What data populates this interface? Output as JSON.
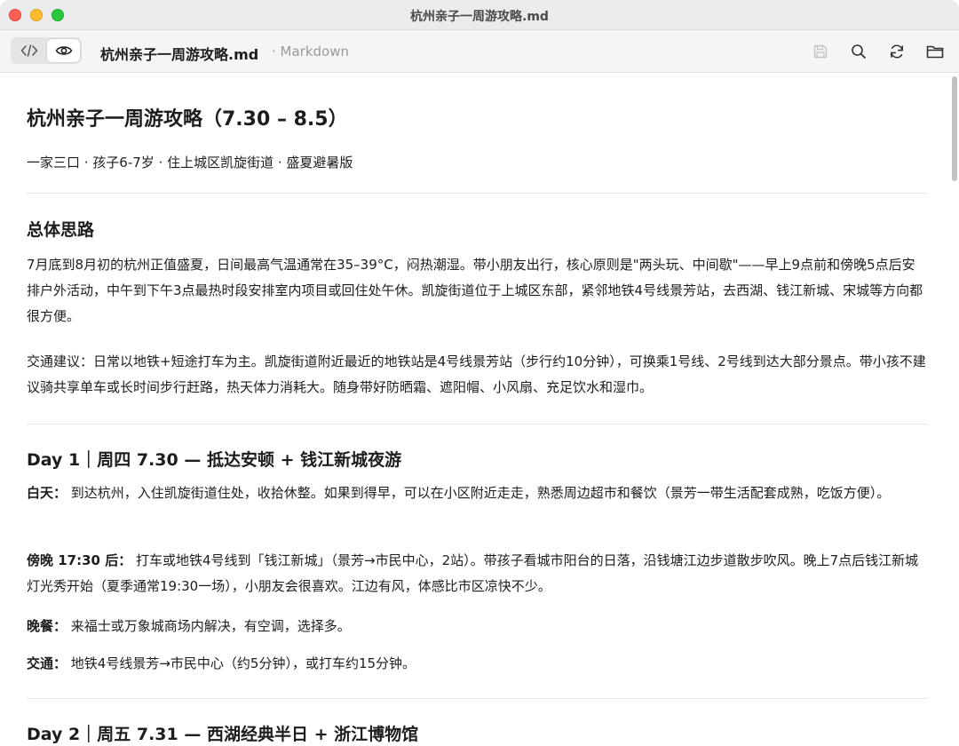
{
  "window": {
    "title": "杭州亲子一周游攻略.md"
  },
  "toolbar": {
    "file_name": "杭州亲子一周游攻略.md",
    "file_type": "· Markdown",
    "mode_code_icon": "code-icon",
    "mode_preview_icon": "eye-icon",
    "save_icon": "save-icon",
    "search_icon": "search-icon",
    "refresh_icon": "refresh-icon",
    "folder_icon": "folder-icon"
  },
  "document": {
    "title": "杭州亲子一周游攻略（7.30 – 8.5）",
    "subtitle": "一家三口 · 孩子6-7岁 · 住上城区凯旋街道 · 盛夏避暑版",
    "overview": {
      "heading": "总体思路",
      "para1": "7月底到8月初的杭州正值盛夏，日间最高气温通常在35–39°C，闷热潮湿。带小朋友出行，核心原则是\"两头玩、中间歇\"——早上9点前和傍晚5点后安排户外活动，中午到下午3点最热时段安排室内项目或回住处午休。凯旋街道位于上城区东部，紧邻地铁4号线景芳站，去西湖、钱江新城、宋城等方向都很方便。",
      "para2": "交通建议：日常以地铁+短途打车为主。凯旋街道附近最近的地铁站是4号线景芳站（步行约10分钟），可换乘1号线、2号线到达大部分景点。带小孩不建议骑共享单车或长时间步行赶路，热天体力消耗大。随身带好防晒霜、遮阳帽、小风扇、充足饮水和湿巾。"
    },
    "day1": {
      "heading": "Day 1｜周四 7.30 — 抵达安顿 + 钱江新城夜游",
      "items": [
        {
          "label": "白天：",
          "text": " 到达杭州，入住凯旋街道住处，收拾休整。如果到得早，可以在小区附近走走，熟悉周边超市和餐饮（景芳一带生活配套成熟，吃饭方便）。"
        },
        {
          "label": "傍晚 17:30 后：",
          "text": " 打车或地铁4号线到「钱江新城」（景芳→市民中心，2站）。带孩子看城市阳台的日落，沿钱塘江边步道散步吹风。晚上7点后钱江新城灯光秀开始（夏季通常19:30一场），小朋友会很喜欢。江边有风，体感比市区凉快不少。"
        },
        {
          "label": "晚餐：",
          "text": " 来福士或万象城商场内解决，有空调，选择多。"
        },
        {
          "label": "交通：",
          "text": " 地铁4号线景芳→市民中心（约5分钟），或打车约15分钟。"
        }
      ]
    },
    "day2": {
      "heading": "Day 2｜周五 7.31 — 西湖经典半日 + 浙江博物馆"
    }
  }
}
